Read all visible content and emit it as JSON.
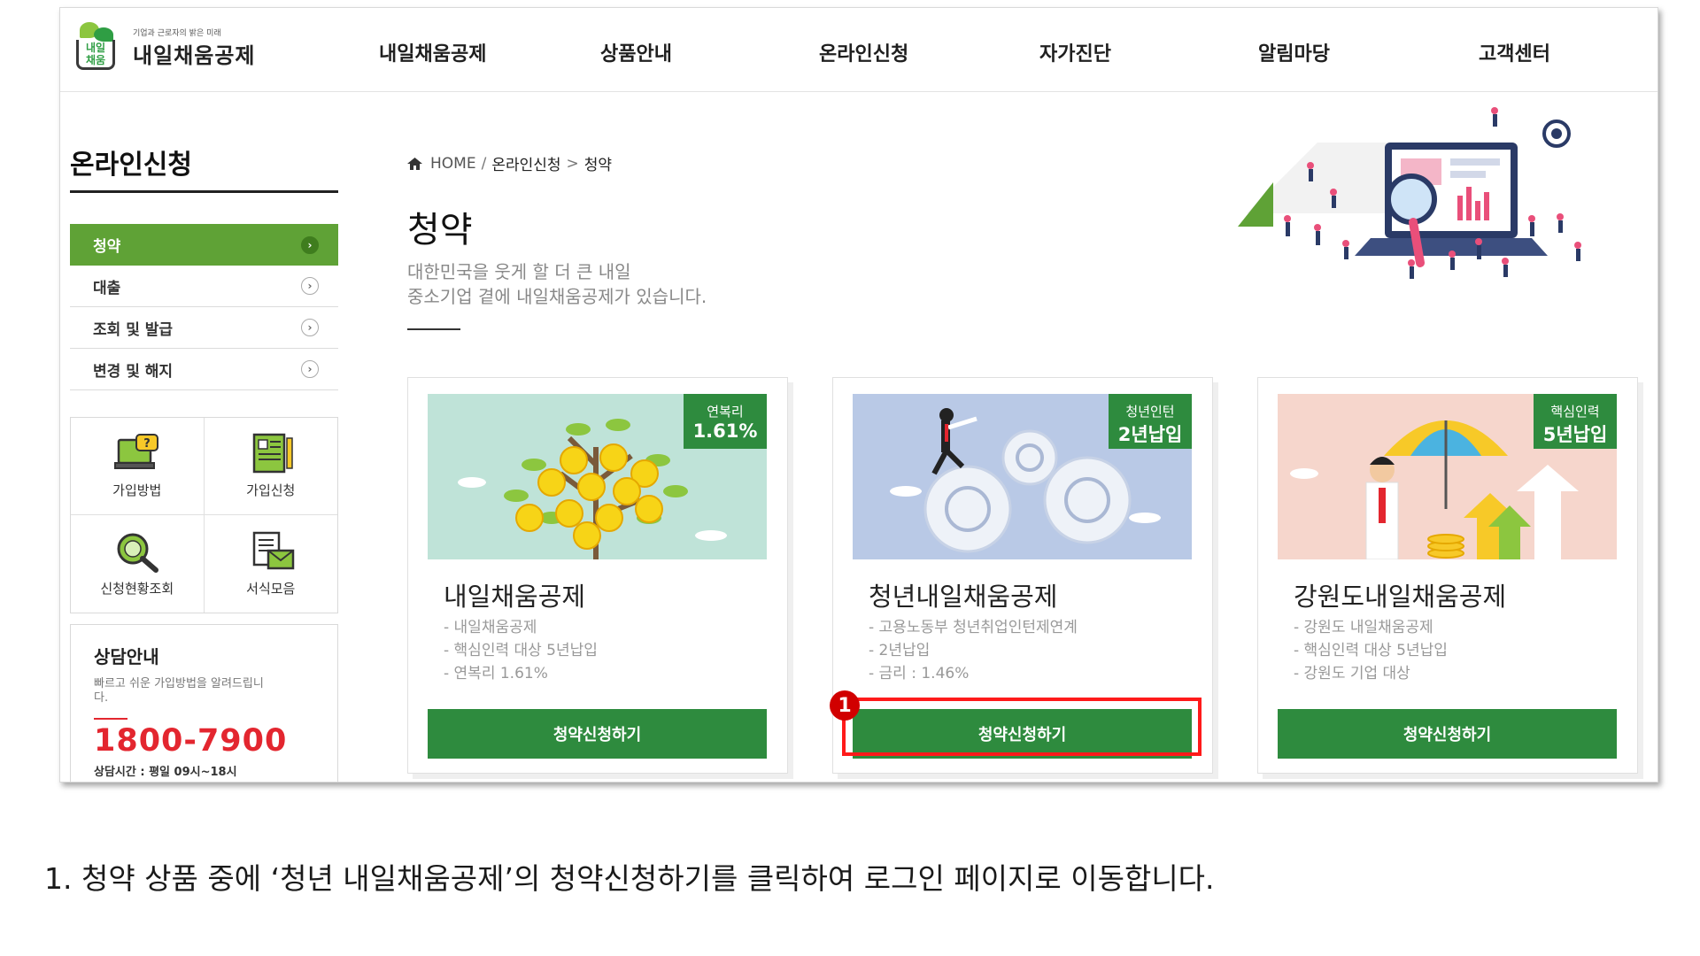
{
  "logo": {
    "sub": "기업과 근로자의 밝은 미래",
    "main": "내일채움공제",
    "mark_text": "내일\n채움"
  },
  "nav": [
    {
      "label": "내일채움공제"
    },
    {
      "label": "상품안내"
    },
    {
      "label": "온라인신청"
    },
    {
      "label": "자가진단"
    },
    {
      "label": "알림마당"
    },
    {
      "label": "고객센터"
    }
  ],
  "sidebar": {
    "title": "온라인신청",
    "items": [
      {
        "label": "청약",
        "active": true
      },
      {
        "label": "대출"
      },
      {
        "label": "조회 및 발급"
      },
      {
        "label": "변경 및 해지"
      }
    ],
    "quick": [
      {
        "label": "가입방법",
        "icon": "question-monitor-icon"
      },
      {
        "label": "가입신청",
        "icon": "application-form-icon"
      },
      {
        "label": "신청현황조회",
        "icon": "magnifier-icon"
      },
      {
        "label": "서식모음",
        "icon": "documents-mail-icon"
      }
    ],
    "consult": {
      "title": "상담안내",
      "desc": "빠르고 쉬운 가입방법을 알려드립니다.",
      "phone": "1800-7900",
      "hours": "상담시간 : 평일 09시~18시"
    }
  },
  "breadcrumb": {
    "home": "HOME",
    "sep1": "/",
    "section": "온라인신청",
    "sep2": ">",
    "current": "청약"
  },
  "page": {
    "title": "청약",
    "desc_line1": "대한민국을 웃게 할 더 큰 내일",
    "desc_line2": "중소기업 곁에 내일채움공제가 있습니다."
  },
  "cards": [
    {
      "badge_top": "연복리",
      "badge_bottom": "1.61%",
      "title": "내일채움공제",
      "lines": [
        "- 내일채움공제",
        "- 핵심인력 대상 5년납입",
        "- 연복리 1.61%"
      ],
      "button": "청약신청하기"
    },
    {
      "badge_top": "청년인턴",
      "badge_bottom": "2년납입",
      "title": "청년내일채움공제",
      "lines": [
        "- 고용노동부 청년취업인턴제연계",
        "- 2년납입",
        "- 금리 : 1.46%"
      ],
      "button": "청약신청하기"
    },
    {
      "badge_top": "핵심인력",
      "badge_bottom": "5년납입",
      "title": "강원도내일채움공제",
      "lines": [
        "- 강원도 내일채움공제",
        "- 핵심인력 대상 5년납입",
        "- 강원도 기업 대상"
      ],
      "button": "청약신청하기"
    }
  ],
  "annotation": {
    "marker": "1"
  },
  "instruction": "1.  청약 상품 중에 ‘청년 내일채움공제’의 청약신청하기를 클릭하여 로그인 페이지로 이동합니다.",
  "colors": {
    "green": "#2e8b3e",
    "menu_active": "#5fa236",
    "red": "#e3262f",
    "highlight": "#ff1a1a"
  }
}
